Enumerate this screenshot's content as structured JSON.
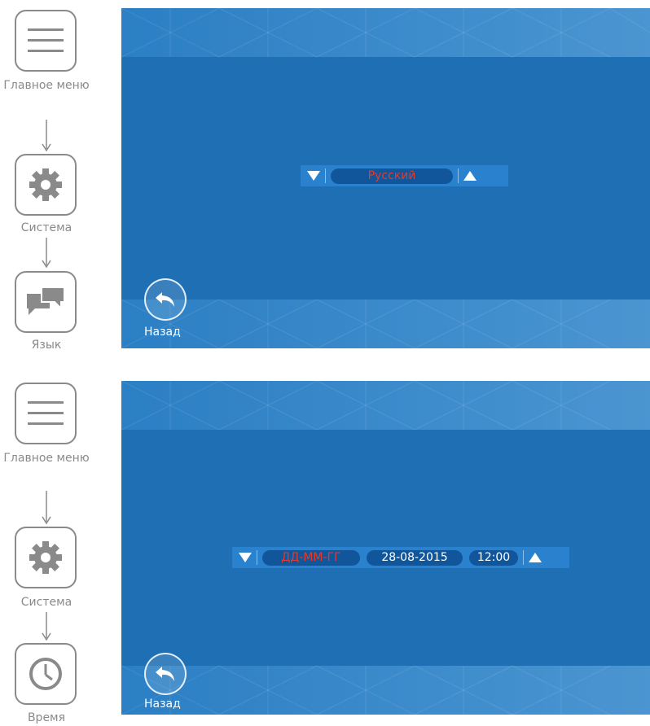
{
  "panels": [
    {
      "nav": [
        {
          "label": "Главное меню",
          "icon": "menu-icon"
        },
        {
          "label": "Система",
          "icon": "gear-icon"
        },
        {
          "label": "Язык",
          "icon": "chat-bubbles-icon"
        }
      ],
      "selector": {
        "value": "Русский"
      },
      "back_label": "Назад"
    },
    {
      "nav": [
        {
          "label": "Главное меню",
          "icon": "menu-icon"
        },
        {
          "label": "Система",
          "icon": "gear-icon"
        },
        {
          "label": "Время",
          "icon": "clock-icon"
        }
      ],
      "selector": {
        "format": "ДД-ММ-ГГ",
        "date": "28-08-2015",
        "time": "12:00"
      },
      "back_label": "Назад"
    }
  ],
  "colors": {
    "screen_bg": "#1e6fb4",
    "active_text": "#e23a2c",
    "pill_bg": "#11569a"
  }
}
